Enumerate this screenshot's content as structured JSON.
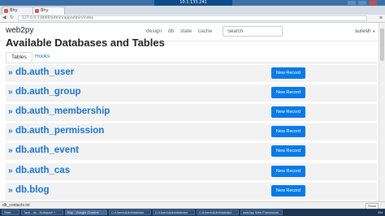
{
  "remote_desktop": {
    "title": "10.1.133.241"
  },
  "browser": {
    "tabs": [
      {
        "label": "Bhy"
      },
      {
        "label": "Bhy"
      }
    ],
    "url": "127.0.0.1:8000/admin/appadmin/index"
  },
  "navbar": {
    "brand": "web2py",
    "links": [
      "design",
      "db",
      "state",
      "cache"
    ],
    "search_placeholder": "Search",
    "user": "suresh"
  },
  "page": {
    "title": "Available Databases and Tables",
    "tabs": [
      "Tables",
      "Hooks"
    ]
  },
  "tables": [
    {
      "name": "db.auth_user",
      "button": "New Record"
    },
    {
      "name": "db.auth_group",
      "button": "New Record"
    },
    {
      "name": "db.auth_membership",
      "button": "New Record"
    },
    {
      "name": "db.auth_permission",
      "button": "New Record"
    },
    {
      "name": "db.auth_event",
      "button": "New Record"
    },
    {
      "name": "db.auth_cas",
      "button": "New Record"
    },
    {
      "name": "db.blog",
      "button": "New Record"
    }
  ],
  "arrow": "»",
  "downloads": {
    "item": "db_contacts.txt",
    "show_all": "Show all"
  },
  "taskbar": {
    "items": [
      "Start",
      "Task - dc - Notepad++",
      "Bhy - Google Chrome",
      "C:\\Users\\Administrator",
      "C:\\Users\\Administrator",
      "C:\\Users\\Administrator",
      "web2py Web Framework"
    ],
    "tray": "EN"
  },
  "colors": {
    "link": "#1a73c8",
    "button": "#0a7ae6",
    "row_bg": "#f2f2f2"
  }
}
